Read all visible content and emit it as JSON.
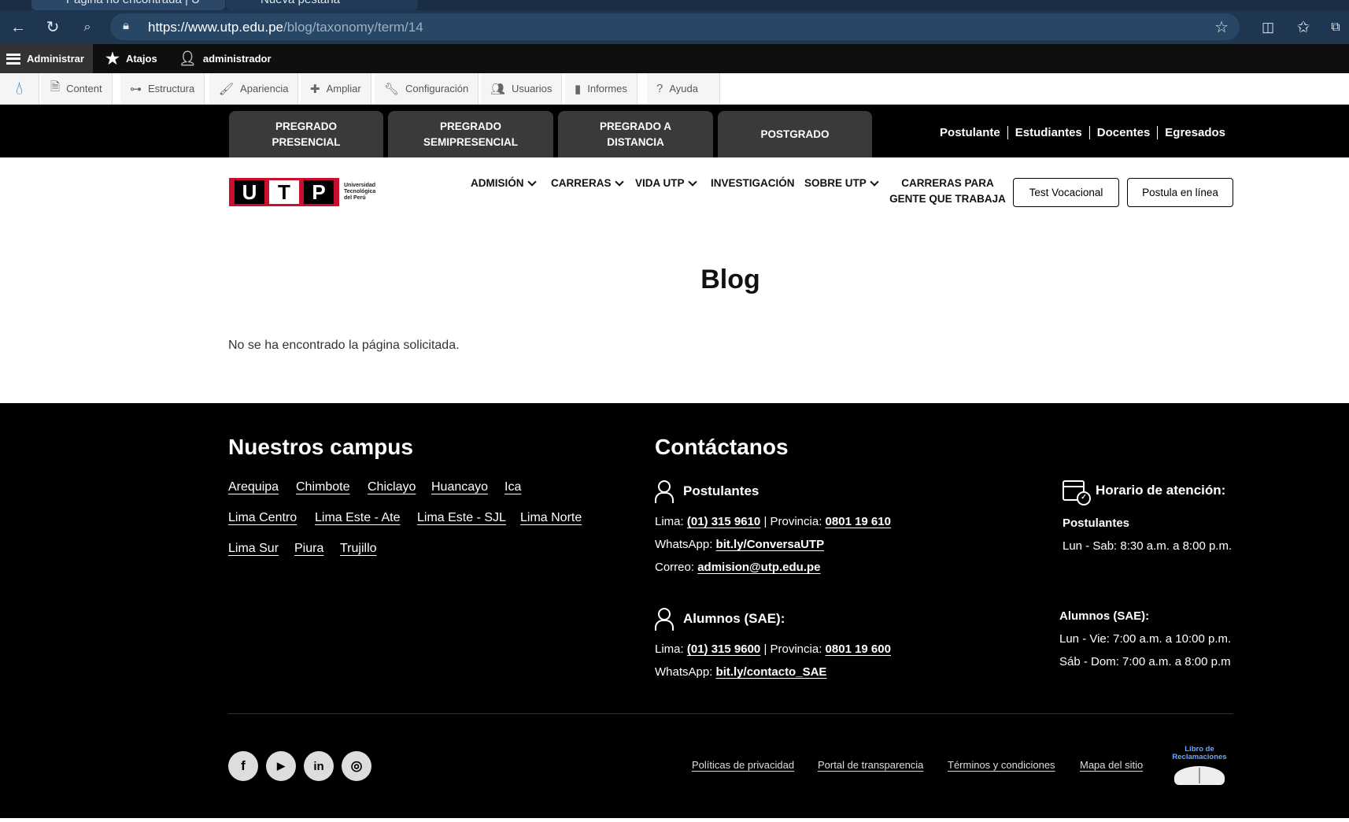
{
  "browser": {
    "tabs": [
      {
        "label": "Página no encontrada | U"
      },
      {
        "label": "Nueva pestaña"
      }
    ],
    "url_host": "https://www.utp.edu.pe",
    "url_path": "/blog/taxonomy/term/14"
  },
  "admin_toolbar": {
    "manage": "Administrar",
    "shortcuts": "Atajos",
    "user": "administrador",
    "menu": [
      {
        "label": "Content",
        "icon": "file-icon"
      },
      {
        "label": "Estructura",
        "icon": "sitemap-icon"
      },
      {
        "label": "Apariencia",
        "icon": "paintbrush-icon"
      },
      {
        "label": "Ampliar",
        "icon": "puzzle-icon"
      },
      {
        "label": "Configuración",
        "icon": "wrench-icon"
      },
      {
        "label": "Usuarios",
        "icon": "users-icon"
      },
      {
        "label": "Informes",
        "icon": "bar-chart-icon"
      },
      {
        "label": "Ayuda",
        "icon": "help-icon"
      }
    ]
  },
  "program_tabs": [
    {
      "line1": "PREGRADO",
      "line2": "PRESENCIAL"
    },
    {
      "line1": "PREGRADO",
      "line2": "SEMIPRESENCIAL"
    },
    {
      "line1": "PREGRADO A",
      "line2": "DISTANCIA"
    },
    {
      "line1": "POSTGRADO",
      "line2": ""
    }
  ],
  "quick_links": [
    "Postulante",
    "Estudiantes",
    "Docentes",
    "Egresados"
  ],
  "logo": {
    "letters": [
      "U",
      "T",
      "P"
    ],
    "line1": "Universidad",
    "line2": "Tecnológica",
    "line3": "del Perú"
  },
  "nav": {
    "admision": "ADMISIÓN",
    "carreras": "CARRERAS",
    "vida": "VIDA UTP",
    "investigacion": "INVESTIGACIÓN",
    "sobre": "SOBRE UTP",
    "gente_line1": "CARRERAS PARA",
    "gente_line2": "GENTE QUE TRABAJA",
    "test": "Test Vocacional",
    "postula": "Postula en línea"
  },
  "page": {
    "title": "Blog",
    "message": "No se ha encontrado la página solicitada."
  },
  "footer": {
    "campus_title": "Nuestros campus",
    "campus": [
      "Arequipa",
      "Chimbote",
      "Chiclayo",
      "Huancayo",
      "Ica",
      "Lima Centro",
      "Lima Este - Ate",
      "Lima Este - SJL",
      "Lima Norte",
      "Lima Sur",
      "Piura",
      "Trujillo"
    ],
    "contact_title": "Contáctanos",
    "postulantes": {
      "heading": "Postulantes",
      "lima_label": "Lima:",
      "lima": "(01) 315 9610",
      "prov_label": "| Provincia:",
      "prov": "0801 19 610",
      "wa_label": "WhatsApp:",
      "wa": "bit.ly/ConversaUTP",
      "mail_label": "Correo:",
      "mail": "admision@utp.edu.pe"
    },
    "alumnos": {
      "heading": "Alumnos (SAE):",
      "lima_label": "Lima:",
      "lima": "(01) 315 9600",
      "prov_label": "| Provincia:",
      "prov": "0801 19 600",
      "wa_label": "WhatsApp:",
      "wa": "bit.ly/contacto_SAE"
    },
    "horario": {
      "heading": "Horario de atención:",
      "post_title": "Postulantes",
      "post_hours": "Lun - Sab: 8:30 a.m. a 8:00 p.m.",
      "alum_title": "Alumnos (SAE):",
      "alum_hours1": "Lun - Vie: 7:00 a.m. a 10:00 p.m.",
      "alum_hours2": "Sáb - Dom: 7:00 a.m. a 8:00 p.m"
    },
    "social": [
      "f",
      "▶",
      "in",
      "◎"
    ],
    "legal": [
      "Políticas de privacidad",
      "Portal de transparencia",
      "Términos y condiciones",
      "Mapa del sitio"
    ],
    "libro_line1": "Libro de",
    "libro_line2": "Reclamaciones"
  }
}
